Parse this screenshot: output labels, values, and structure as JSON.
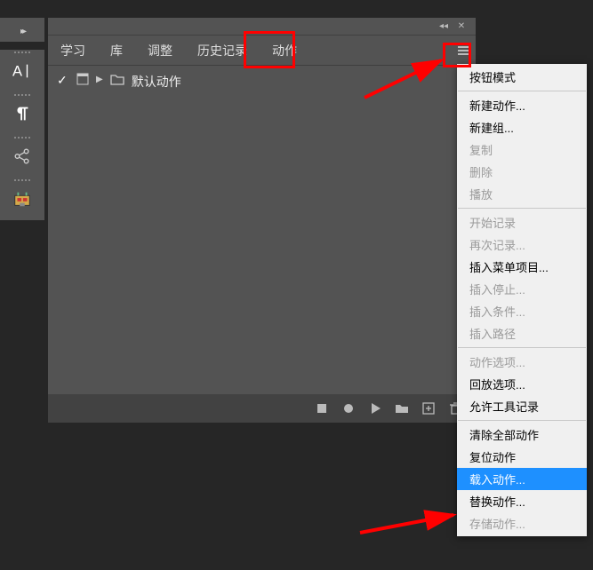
{
  "toolstrip": {
    "tools": [
      "text-tool",
      "paragraph-tool",
      "share-tool",
      "plugin-tool"
    ]
  },
  "panel": {
    "tabs": [
      "学习",
      "库",
      "调整",
      "历史记录",
      "动作"
    ],
    "active_tab_index": 4,
    "content": {
      "default_actions_label": "默认动作"
    },
    "bottom_toolbar": {
      "buttons": [
        "stop",
        "record",
        "play",
        "new-set",
        "new-action",
        "delete"
      ]
    }
  },
  "menu": {
    "groups": [
      {
        "items": [
          {
            "label": "按钮模式",
            "disabled": false
          }
        ]
      },
      {
        "items": [
          {
            "label": "新建动作...",
            "disabled": false
          },
          {
            "label": "新建组...",
            "disabled": false
          },
          {
            "label": "复制",
            "disabled": true
          },
          {
            "label": "删除",
            "disabled": true
          },
          {
            "label": "播放",
            "disabled": true
          }
        ]
      },
      {
        "items": [
          {
            "label": "开始记录",
            "disabled": true
          },
          {
            "label": "再次记录...",
            "disabled": true
          },
          {
            "label": "插入菜单项目...",
            "disabled": false
          },
          {
            "label": "插入停止...",
            "disabled": true
          },
          {
            "label": "插入条件...",
            "disabled": true
          },
          {
            "label": "插入路径",
            "disabled": true
          }
        ]
      },
      {
        "items": [
          {
            "label": "动作选项...",
            "disabled": true
          },
          {
            "label": "回放选项...",
            "disabled": false
          },
          {
            "label": "允许工具记录",
            "disabled": false
          }
        ]
      },
      {
        "items": [
          {
            "label": "清除全部动作",
            "disabled": false
          },
          {
            "label": "复位动作",
            "disabled": false
          },
          {
            "label": "载入动作...",
            "disabled": false,
            "highlight": true
          },
          {
            "label": "替换动作...",
            "disabled": false
          },
          {
            "label": "存储动作...",
            "disabled": true
          }
        ]
      }
    ]
  },
  "annotations": {
    "highlight_tab": "动作",
    "highlight_menu_item": "载入动作..."
  }
}
